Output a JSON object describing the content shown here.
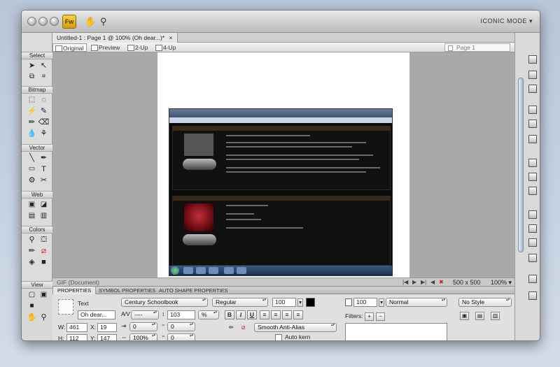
{
  "app": {
    "logo_text": "Fw",
    "mode_label": "ICONIC MODE ▾"
  },
  "document": {
    "tab_title": "Untitled-1 : Page 1 @ 100% (Oh dear...)*",
    "close_icon": "×"
  },
  "view_bar": {
    "views": [
      "Original",
      "Preview",
      "2-Up",
      "4-Up"
    ],
    "active_view": "Original",
    "page_selector": "Page 1"
  },
  "tools": {
    "sections": [
      "Select",
      "Bitmap",
      "Vector",
      "Web",
      "Colors",
      "View"
    ]
  },
  "status_bar": {
    "file_type": "GIF (Document)",
    "canvas_size": "500 x 500",
    "zoom": "100% ▾"
  },
  "properties": {
    "tabs": [
      "PROPERTIES",
      "SYMBOL PROPERTIES",
      "AUTO SHAPE PROPERTIES"
    ],
    "object_type": "Text",
    "object_name": "Oh dear...",
    "font_family": "Century Schoolbook",
    "font_style": "Regular",
    "font_size": "100",
    "kerning": "----",
    "leading": "103",
    "leading_unit": "%",
    "indent": "0",
    "space_before": "0",
    "horizontal_scale": "100%",
    "space_after": "0",
    "width": "461",
    "x": "19",
    "height": "112",
    "y": "147",
    "w_label": "W:",
    "x_label": "X:",
    "h_label": "H:",
    "y_label": "Y:",
    "bold": "B",
    "italic": "I",
    "underline": "U",
    "anti_alias": "Smooth Anti-Alias",
    "auto_kern": "Auto kern",
    "opacity": "100",
    "blend_mode": "Normal",
    "filters_label": "Filters:",
    "add_filter": "+",
    "remove_filter": "−",
    "style": "No Style"
  },
  "colors": {
    "text_fill": "#000000",
    "accent": "#f3c634"
  }
}
